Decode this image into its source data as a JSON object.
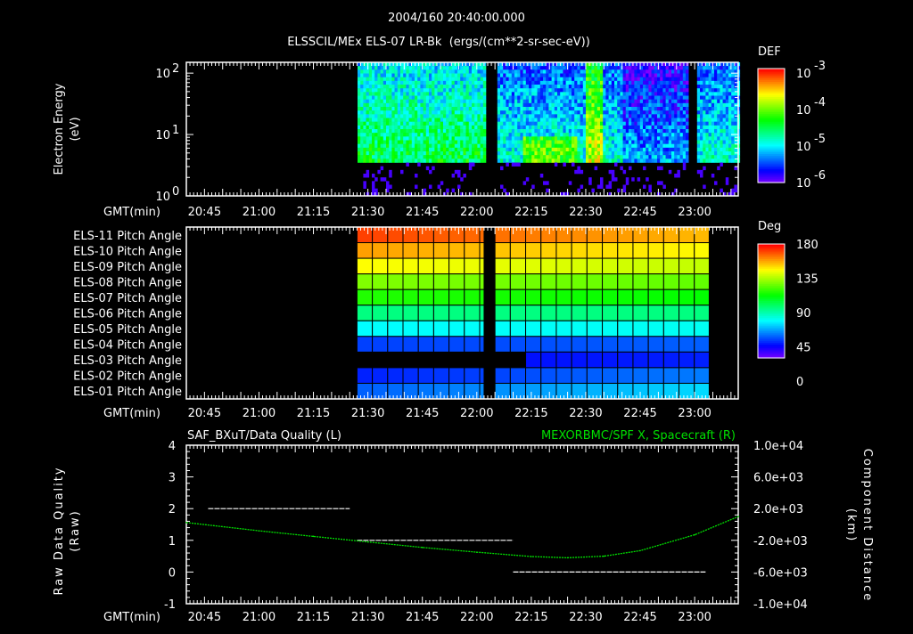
{
  "header": {
    "title": "2004/160 20:40:00.000",
    "subtitle": "ELSSCIL/MEx ELS-07 LR-Bk  (ergs/(cm**2-sr-sec-eV))"
  },
  "time_axis": {
    "label": "GMT(min)",
    "start": "20:40",
    "end": "23:12",
    "ticks": [
      "20:45",
      "21:00",
      "21:15",
      "21:30",
      "21:45",
      "22:00",
      "22:15",
      "22:30",
      "22:45",
      "23:00"
    ]
  },
  "chart_data": [
    {
      "type": "heatmap",
      "name": "spectrogram",
      "ylabel": "Electron Energy\n(eV)",
      "ylabel_lines": [
        "Electron Energy",
        "(eV)"
      ],
      "yscale": "log",
      "ylim": [
        1,
        150
      ],
      "yticks": [
        {
          "base": "10",
          "exp": "0",
          "value": 1
        },
        {
          "base": "10",
          "exp": "1",
          "value": 10
        },
        {
          "base": "10",
          "exp": "2",
          "value": 100
        }
      ],
      "colorbar": {
        "title": "DEF",
        "scale": "log",
        "range": [
          1e-06,
          0.001
        ],
        "ticks": [
          {
            "base": "10",
            "exp": "-3"
          },
          {
            "base": "10",
            "exp": "-4"
          },
          {
            "base": "10",
            "exp": "-5"
          },
          {
            "base": "10",
            "exp": "-6"
          }
        ]
      },
      "data_intervals": [
        [
          "21:27",
          "22:02"
        ],
        [
          "22:05",
          "22:58"
        ],
        [
          "23:00",
          "23:12"
        ]
      ],
      "features": [
        {
          "time": "22:32",
          "note": "high-energy enhancement"
        }
      ]
    },
    {
      "type": "heatmap",
      "name": "pitch-angle",
      "colorbar": {
        "title": "Deg",
        "range": [
          0,
          180
        ],
        "ticks": [
          "180",
          "135",
          "90",
          "45",
          "0"
        ]
      },
      "rows": [
        {
          "label": "ELS-11 Pitch Angle",
          "start": 170,
          "end": 150
        },
        {
          "label": "ELS-10 Pitch Angle",
          "start": 155,
          "end": 140
        },
        {
          "label": "ELS-09 Pitch Angle",
          "start": 140,
          "end": 130
        },
        {
          "label": "ELS-08 Pitch Angle",
          "start": 120,
          "end": 115
        },
        {
          "label": "ELS-07 Pitch Angle",
          "start": 105,
          "end": 100
        },
        {
          "label": "ELS-06 Pitch Angle",
          "start": 80,
          "end": 80
        },
        {
          "label": "ELS-05 Pitch Angle",
          "start": 60,
          "end": 62
        },
        {
          "label": "ELS-04 Pitch Angle",
          "start": 30,
          "end": 35
        },
        {
          "label": "ELS-03 Pitch Angle",
          "start": 20,
          "end": 25,
          "from": "22:13"
        },
        {
          "label": "ELS-02 Pitch Angle",
          "start": 25,
          "end": 40
        },
        {
          "label": "ELS-01 Pitch Angle",
          "start": 35,
          "end": 55
        }
      ],
      "data_intervals": [
        [
          "21:27",
          "22:02"
        ],
        [
          "22:05",
          "23:04"
        ]
      ]
    },
    {
      "type": "line",
      "name": "data-quality-and-position",
      "left_title": "SAF_BXuT/Data Quality (L)",
      "right_title": "MEXORBMC/SPF X, Spacecraft (R)",
      "ylabel_left": [
        "Raw Data Quality",
        "(Raw)"
      ],
      "ylabel_right": [
        "Component Distance",
        "(km)"
      ],
      "ylim_left": [
        -1,
        4
      ],
      "yticks_left": [
        "4",
        "3",
        "2",
        "1",
        "0",
        "-1"
      ],
      "ylim_right": [
        -10000,
        10000
      ],
      "yticks_right": [
        "1.0e+04",
        "6.0e+03",
        "2.0e+03",
        "-2.0e+03",
        "-6.0e+03",
        "-1.0e+04"
      ],
      "quality_series": [
        {
          "from": "20:46",
          "to": "21:25",
          "value": 2
        },
        {
          "from": "21:27",
          "to": "22:10",
          "value": 1
        },
        {
          "from": "22:10",
          "to": "23:03",
          "value": 0
        }
      ],
      "position_series": {
        "x": [
          "20:40",
          "21:00",
          "21:15",
          "21:30",
          "21:45",
          "22:00",
          "22:15",
          "22:25",
          "22:35",
          "22:45",
          "23:00",
          "23:12"
        ],
        "y": [
          250,
          -800,
          -1500,
          -2200,
          -2900,
          -3500,
          -4050,
          -4200,
          -4000,
          -3300,
          -1300,
          1000
        ]
      },
      "colors": {
        "quality": "#ffffff",
        "position": "#00e000"
      }
    }
  ]
}
